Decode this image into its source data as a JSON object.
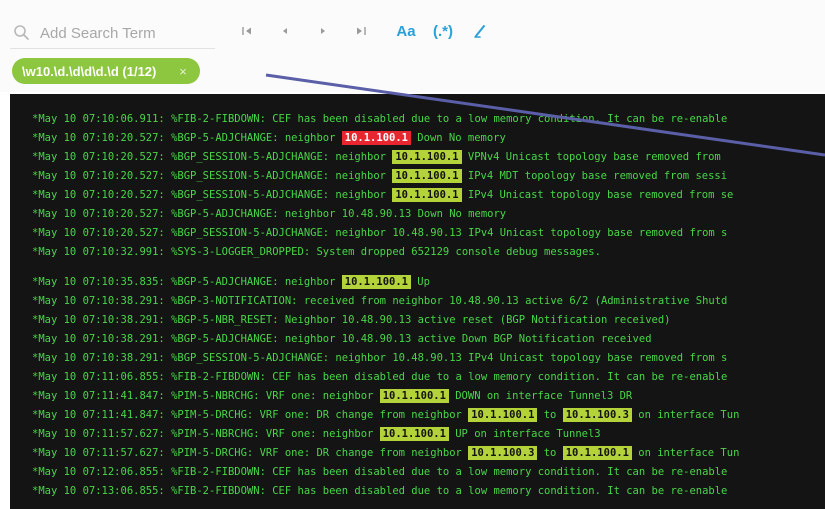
{
  "search": {
    "placeholder": "Add Search Term",
    "buttons": {
      "case": "Aa",
      "regex": "(.*)"
    }
  },
  "filter_chip": {
    "label": "\\w10.\\d.\\d\\d\\d.\\d (1/12)",
    "close": "×"
  },
  "icons": {
    "search": "search-icon",
    "first": "first-match-icon",
    "prev": "prev-match-icon",
    "next": "next-match-icon",
    "last": "last-match-icon",
    "highlight": "highlighter-icon",
    "close": "close-icon"
  },
  "colors": {
    "accent": "#2a9fd8",
    "chip": "#8dc63f",
    "terminal_bg": "#141414",
    "terminal_text": "#48d648",
    "match": "#b4d23a",
    "current_match": "#e8262f",
    "annotation": "#5a5fa8"
  },
  "log_lines": [
    {
      "segments": [
        {
          "t": "*May 10 07:10:06.911: %FIB-2-FIBDOWN: CEF has been disabled due to a low memory condition. It can be re-enable"
        }
      ]
    },
    {
      "segments": [
        {
          "t": "*May 10 07:10:20.527: %BGP-5-ADJCHANGE: neighbor "
        },
        {
          "t": "10.1.100.1",
          "hl": "current"
        },
        {
          "t": " Down No memory"
        }
      ]
    },
    {
      "segments": [
        {
          "t": "*May 10 07:10:20.527: %BGP_SESSION-5-ADJCHANGE: neighbor "
        },
        {
          "t": "10.1.100.1",
          "hl": "match"
        },
        {
          "t": " VPNv4 Unicast topology base removed from"
        }
      ]
    },
    {
      "segments": [
        {
          "t": "*May 10 07:10:20.527: %BGP_SESSION-5-ADJCHANGE: neighbor "
        },
        {
          "t": "10.1.100.1",
          "hl": "match"
        },
        {
          "t": " IPv4 MDT topology base removed from sessi"
        }
      ]
    },
    {
      "segments": [
        {
          "t": "*May 10 07:10:20.527: %BGP_SESSION-5-ADJCHANGE: neighbor "
        },
        {
          "t": "10.1.100.1",
          "hl": "match"
        },
        {
          "t": " IPv4 Unicast topology base removed from se"
        }
      ]
    },
    {
      "segments": [
        {
          "t": "*May 10 07:10:20.527: %BGP-5-ADJCHANGE: neighbor 10.48.90.13 Down No memory"
        }
      ]
    },
    {
      "segments": [
        {
          "t": "*May 10 07:10:20.527: %BGP_SESSION-5-ADJCHANGE: neighbor 10.48.90.13 IPv4 Unicast topology base removed from s"
        }
      ]
    },
    {
      "segments": [
        {
          "t": "*May 10 07:10:32.991: %SYS-3-LOGGER_DROPPED: System dropped 652129 console debug messages."
        }
      ]
    },
    {
      "blank": true,
      "segments": []
    },
    {
      "segments": [
        {
          "t": "*May 10 07:10:35.835: %BGP-5-ADJCHANGE: neighbor "
        },
        {
          "t": "10.1.100.1",
          "hl": "match"
        },
        {
          "t": " Up"
        }
      ]
    },
    {
      "segments": [
        {
          "t": "*May 10 07:10:38.291: %BGP-3-NOTIFICATION: received from neighbor 10.48.90.13 active 6/2 (Administrative Shutd"
        }
      ]
    },
    {
      "segments": [
        {
          "t": "*May 10 07:10:38.291: %BGP-5-NBR_RESET: Neighbor 10.48.90.13 active reset (BGP Notification received)"
        }
      ]
    },
    {
      "segments": [
        {
          "t": "*May 10 07:10:38.291: %BGP-5-ADJCHANGE: neighbor 10.48.90.13 active Down BGP Notification received"
        }
      ]
    },
    {
      "segments": [
        {
          "t": "*May 10 07:10:38.291: %BGP_SESSION-5-ADJCHANGE: neighbor 10.48.90.13 IPv4 Unicast topology base removed from s"
        }
      ]
    },
    {
      "segments": [
        {
          "t": "*May 10 07:11:06.855: %FIB-2-FIBDOWN: CEF has been disabled due to a low memory condition. It can be re-enable"
        }
      ]
    },
    {
      "segments": [
        {
          "t": "*May 10 07:11:41.847: %PIM-5-NBRCHG: VRF one: neighbor "
        },
        {
          "t": "10.1.100.1",
          "hl": "match"
        },
        {
          "t": " DOWN on interface Tunnel3 DR"
        }
      ]
    },
    {
      "segments": [
        {
          "t": "*May 10 07:11:41.847: %PIM-5-DRCHG: VRF one: DR change from neighbor "
        },
        {
          "t": "10.1.100.1",
          "hl": "match"
        },
        {
          "t": " to "
        },
        {
          "t": "10.1.100.3",
          "hl": "match"
        },
        {
          "t": " on interface Tun"
        }
      ]
    },
    {
      "segments": [
        {
          "t": "*May 10 07:11:57.627: %PIM-5-NBRCHG: VRF one: neighbor "
        },
        {
          "t": "10.1.100.1",
          "hl": "match"
        },
        {
          "t": " UP on interface Tunnel3"
        }
      ]
    },
    {
      "segments": [
        {
          "t": "*May 10 07:11:57.627: %PIM-5-DRCHG: VRF one: DR change from neighbor "
        },
        {
          "t": "10.1.100.3",
          "hl": "match"
        },
        {
          "t": " to "
        },
        {
          "t": "10.1.100.1",
          "hl": "match"
        },
        {
          "t": " on interface Tun"
        }
      ]
    },
    {
      "segments": [
        {
          "t": "*May 10 07:12:06.855: %FIB-2-FIBDOWN: CEF has been disabled due to a low memory condition. It can be re-enable"
        }
      ]
    },
    {
      "segments": [
        {
          "t": "*May 10 07:13:06.855: %FIB-2-FIBDOWN: CEF has been disabled due to a low memory condition. It can be re-enable"
        }
      ]
    }
  ]
}
